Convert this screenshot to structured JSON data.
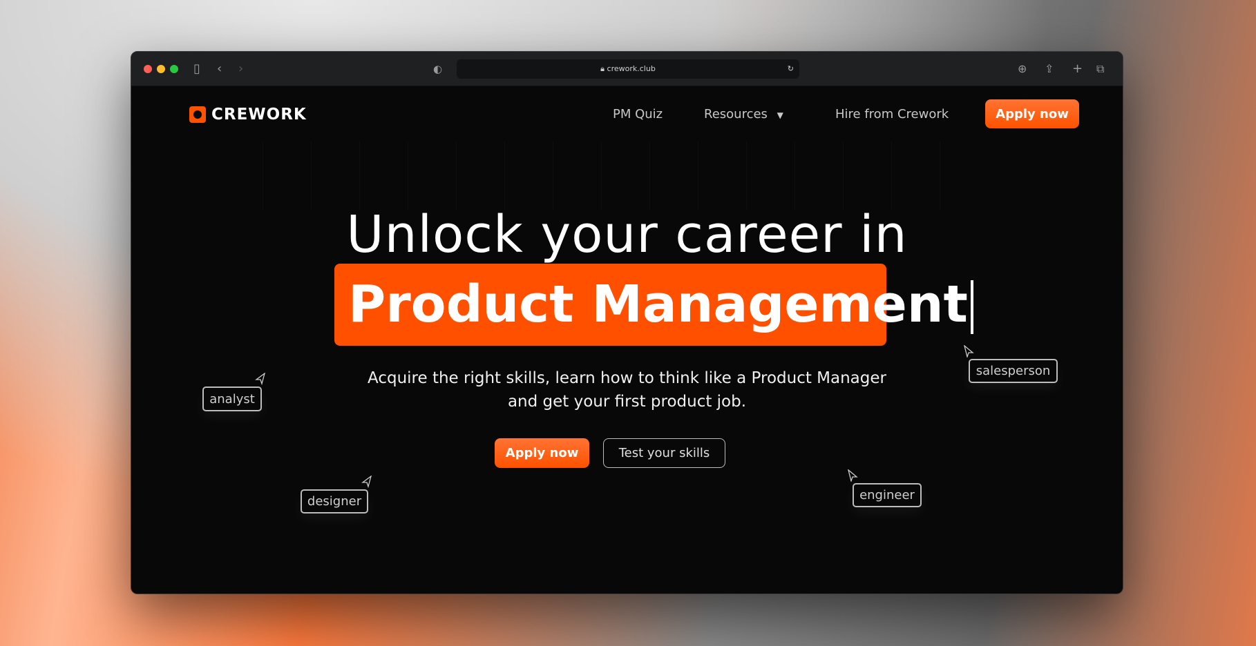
{
  "browser": {
    "url": "crework.club",
    "traffic_colors": [
      "#fe5f57",
      "#febc2e",
      "#28c840"
    ]
  },
  "nav": {
    "brand": "CREWORK",
    "items": [
      "PM Quiz",
      "Resources",
      "Hire from Crework"
    ],
    "cta": "Apply now"
  },
  "hero": {
    "title": "Unlock your career in",
    "highlight": "Product Management",
    "subtitle_1": "Acquire the right skills, learn how to think like a Product Manager",
    "subtitle_2": "and get your first product job.",
    "primary": "Apply now",
    "secondary": "Test your skills"
  },
  "tags": [
    "analyst",
    "salesperson",
    "designer",
    "engineer"
  ],
  "colors": {
    "accent": "#ff5200",
    "background": "#080808"
  }
}
